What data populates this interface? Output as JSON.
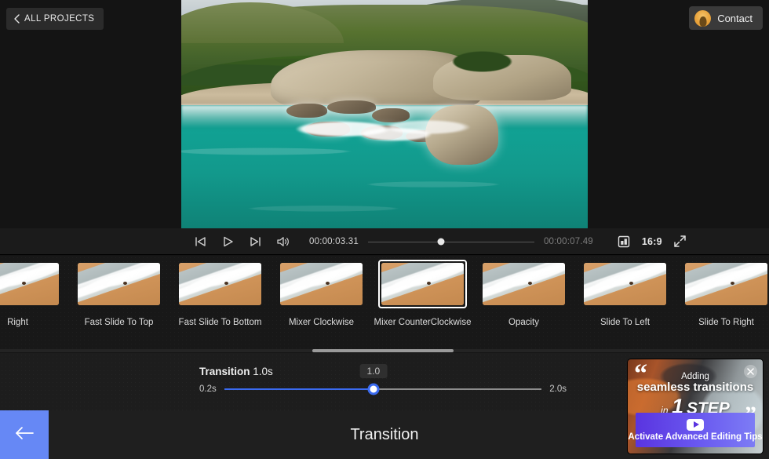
{
  "header": {
    "all_projects_label": "ALL PROJECTS",
    "all_projects_icon": "chevron-left-icon",
    "contact_label": "Contact",
    "avatar_icon": "user-avatar-icon"
  },
  "player": {
    "prev_icon": "skip-previous-icon",
    "play_icon": "play-icon",
    "next_icon": "skip-next-icon",
    "volume_icon": "speaker-icon",
    "current_time": "00:00:03.31",
    "total_time": "00:00:07.49",
    "scrub_percent": 44,
    "crop_icon": "crop-icon",
    "aspect_ratio": "16:9",
    "fullscreen_icon": "fullscreen-icon"
  },
  "transitions": {
    "items": [
      {
        "label": "Right",
        "selected": false
      },
      {
        "label": "Fast Slide To Top",
        "selected": false
      },
      {
        "label": "Fast Slide To Bottom",
        "selected": false
      },
      {
        "label": "Mixer Clockwise",
        "selected": false
      },
      {
        "label": "Mixer CounterClockwise",
        "selected": true
      },
      {
        "label": "Opacity",
        "selected": false
      },
      {
        "label": "Slide To Left",
        "selected": false
      },
      {
        "label": "Slide To Right",
        "selected": false
      },
      {
        "label": "",
        "selected": false
      }
    ]
  },
  "parameter": {
    "name": "Transition",
    "value_text": "1.0s",
    "min_label": "0.2s",
    "max_label": "2.0s",
    "tooltip_value": "1.0",
    "fill_percent": 47,
    "accent_color": "#3b6bf0"
  },
  "bottom": {
    "back_icon": "arrow-left-icon",
    "title": "Transition",
    "back_color": "#6688f5"
  },
  "ad": {
    "close_icon": "close-icon",
    "quote_open": "“",
    "quote_close": "”",
    "line1": "Adding",
    "line2": "seamless transitions",
    "line3_small": "in",
    "line3_number": "1",
    "line3_step": "STEP",
    "cta_icon": "youtube-play-icon",
    "cta_label": "Activate Advanced Editing Tips"
  }
}
